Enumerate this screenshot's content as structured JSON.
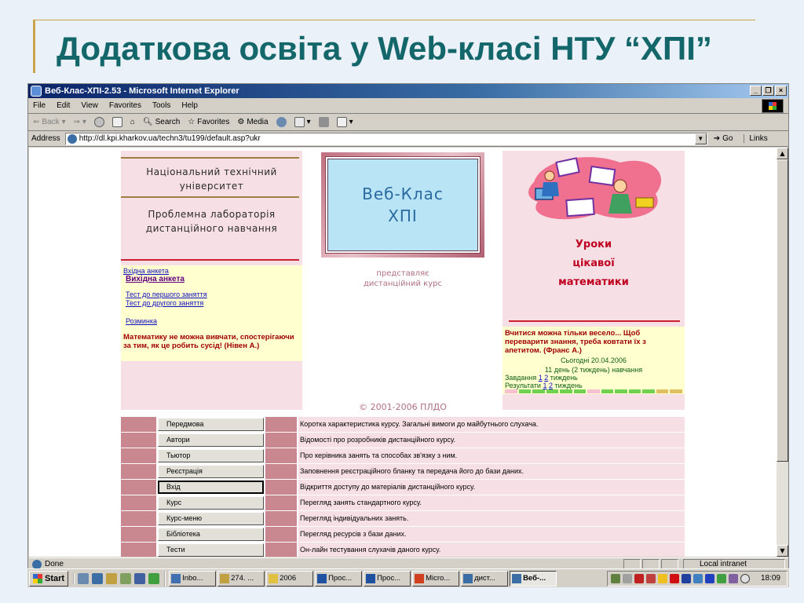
{
  "slide": {
    "title": "Додаткова освіта у Web-класі НТУ “ХПІ”"
  },
  "browser": {
    "window_title": "Веб-Клас-ХПІ-2.53 - Microsoft Internet Explorer",
    "menu": [
      "File",
      "Edit",
      "View",
      "Favorites",
      "Tools",
      "Help"
    ],
    "toolbar": {
      "back": "Back",
      "search": "Search",
      "favorites": "Favorites",
      "media": "Media"
    },
    "address_label": "Address",
    "address_url": "http://dl.kpi.kharkov.ua/techn3/tu199/default.asp?ukr",
    "go": "Go",
    "links": "Links",
    "status": "Done",
    "zone": "Local intranet"
  },
  "page": {
    "left": {
      "university": "Національний технічний університет",
      "lab": "Проблемна лабораторія дистанційного навчання",
      "links": {
        "entry_form": "Вхідна анкета",
        "exit_form": "Вихідна анкета",
        "test_first": "Тест до першого заняття",
        "test_second": "Тест до другого заняття",
        "warmup": "Розминка"
      },
      "quote": "Математику не можна вивчати, спостерігаючи за тим, як це робить сусід! (Нівен А.)"
    },
    "middle": {
      "logo_line1": "Веб-Клас",
      "logo_line2": "ХПІ",
      "presents_line1": "представляє",
      "presents_line2": "дистанційний курс",
      "copyright": "© 2001-2006 ПЛДО"
    },
    "right": {
      "lessons_line1": "Уроки",
      "lessons_line2": "цікавої",
      "lessons_line3": "математики",
      "quote": "Вчитися можна тільки весело... Щоб переварити знання, треба ковтати їх з апетитом. (Франс А.)",
      "today": "Сьогодні 20.04.2006",
      "day": "11 день (2 тиждень) навчання",
      "tasks_label": "Завдання",
      "tasks_n1": "1",
      "tasks_n2": "2",
      "tasks_suffix": "тиждень",
      "results_label": "Результати",
      "results_n1": "1",
      "results_n2": "2",
      "results_suffix": "тиждень"
    },
    "nav": [
      {
        "label": "Передмова",
        "desc": "Коротка характеристика курсу. Загальні вимоги до майбутнього слухача."
      },
      {
        "label": "Автори",
        "desc": "Відомості про розробників дистанційного курсу."
      },
      {
        "label": "Тьютор",
        "desc": "Про керівника занять та способах зв'язку з ним."
      },
      {
        "label": "Реєстрація",
        "desc": "Заповнення реєстраційного бланку та передача його до бази даних."
      },
      {
        "label": "Вхід",
        "desc": "Відкриття доступу до матеріалів дистанційного курсу."
      },
      {
        "label": "Курс",
        "desc": "Перегляд занять стандартного курсу."
      },
      {
        "label": "Курс-меню",
        "desc": "Перегляд індивідуальних занять."
      },
      {
        "label": "Бібліотека",
        "desc": "Перегляд ресурсів з бази даних."
      },
      {
        "label": "Тести",
        "desc": "Он-лайн тестування слухачів даного курсу."
      }
    ]
  },
  "taskbar": {
    "start": "Start",
    "tasks": [
      "Inbo...",
      "274. ...",
      "2006",
      "Прос...",
      "Прос...",
      "Micro...",
      "дист...",
      "Веб-..."
    ],
    "clock": "18:09"
  },
  "colors": {
    "title": "#13676a",
    "rose": "#c98890",
    "pink_bg": "#f7dfe6",
    "yellow_bg": "#ffffd0",
    "accent_red": "#cc2030"
  }
}
